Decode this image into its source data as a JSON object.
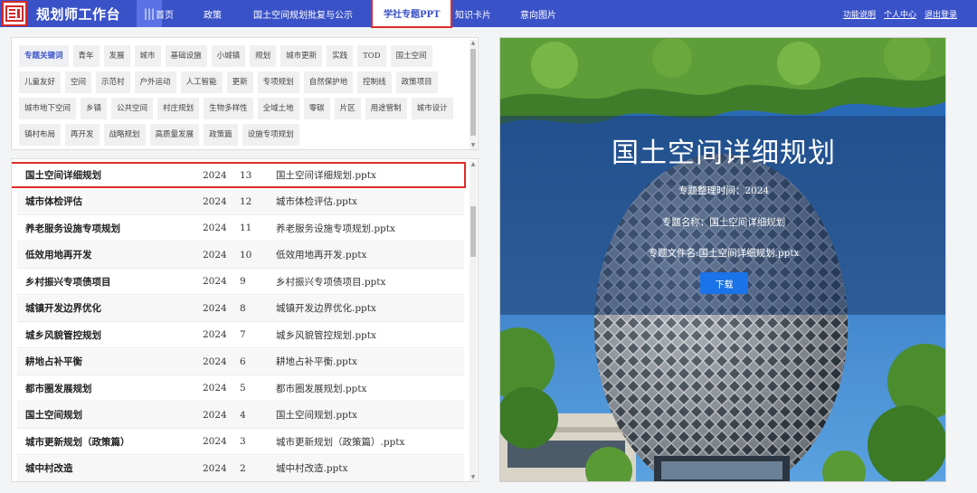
{
  "app": {
    "title": "规划师工作台"
  },
  "nav": {
    "items": [
      "首页",
      "政策",
      "国土空间规划批复与公示",
      "学社专题PPT",
      "知识卡片",
      "意向图片"
    ],
    "active_index": 3
  },
  "header_links": [
    "功能说明",
    "个人中心",
    "退出登录"
  ],
  "keywords": {
    "head": "专题关键词",
    "items": [
      "青年",
      "发展",
      "城市",
      "基础设施",
      "小城镇",
      "规划",
      "城市更新",
      "实践",
      "TOD",
      "国土空间",
      "儿童友好",
      "空间",
      "示范村",
      "户外运动",
      "人工智能",
      "更新",
      "专项规划",
      "自然保护地",
      "控制线",
      "政策项目",
      "城市地下空间",
      "乡镇",
      "公共空间",
      "村庄规划",
      "生物多样性",
      "全域土地",
      "零碳",
      "片区",
      "用途管制",
      "城市设计",
      "镇村布局",
      "再开发",
      "战略规划",
      "高质量发展",
      "政策篇",
      "设施专项规划"
    ]
  },
  "list": {
    "rows": [
      {
        "name": "国土空间详细规划",
        "year": "2024",
        "num": "13",
        "file": "国土空间详细规划.pptx"
      },
      {
        "name": "城市体检评估",
        "year": "2024",
        "num": "12",
        "file": "城市体检评估.pptx"
      },
      {
        "name": "养老服务设施专项规划",
        "year": "2024",
        "num": "11",
        "file": "养老服务设施专项规划.pptx"
      },
      {
        "name": "低效用地再开发",
        "year": "2024",
        "num": "10",
        "file": "低效用地再开发.pptx"
      },
      {
        "name": "乡村振兴专项债项目",
        "year": "2024",
        "num": "9",
        "file": "乡村振兴专项债项目.pptx"
      },
      {
        "name": "城镇开发边界优化",
        "year": "2024",
        "num": "8",
        "file": "城镇开发边界优化.pptx"
      },
      {
        "name": "城乡风貌管控规划",
        "year": "2024",
        "num": "7",
        "file": "城乡风貌管控规划.pptx"
      },
      {
        "name": "耕地占补平衡",
        "year": "2024",
        "num": "6",
        "file": "耕地占补平衡.pptx"
      },
      {
        "name": "都市圈发展规划",
        "year": "2024",
        "num": "5",
        "file": "都市圈发展规划.pptx"
      },
      {
        "name": "国土空间规划",
        "year": "2024",
        "num": "4",
        "file": "国土空间规划.pptx"
      },
      {
        "name": "城市更新规划（政策篇）",
        "year": "2024",
        "num": "3",
        "file": "城市更新规划（政策篇）.pptx"
      },
      {
        "name": "城中村改造",
        "year": "2024",
        "num": "2",
        "file": "城中村改造.pptx"
      }
    ],
    "selected_index": 0
  },
  "preview": {
    "title": "国土空间详细规划",
    "time_line": "专题整理时间：2024",
    "name_line": "专题名称：国土空间详细规划",
    "file_line": "专题文件名:国土空间详细规划.pptx",
    "download_label": "下载"
  }
}
